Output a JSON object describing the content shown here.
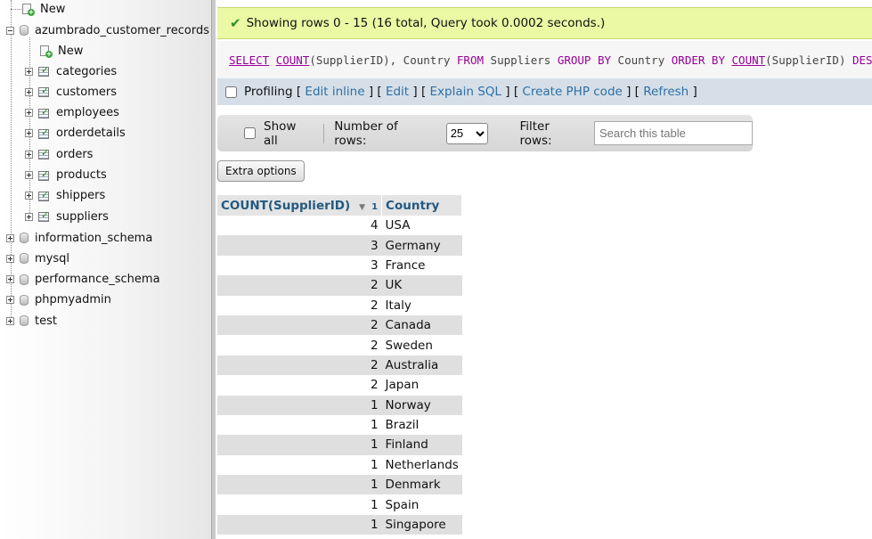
{
  "nav": {
    "top_new": "New",
    "database": "azumbrado_customer_records",
    "db_new": "New",
    "tables": [
      "categories",
      "customers",
      "employees",
      "orderdetails",
      "orders",
      "products",
      "shippers",
      "suppliers"
    ],
    "other_databases": [
      "information_schema",
      "mysql",
      "performance_schema",
      "phpmyadmin",
      "test"
    ]
  },
  "message": {
    "text": "Showing rows 0 - 15 (16 total, Query took 0.0002 seconds.)",
    "color": "#ebf8a4"
  },
  "sql": {
    "select": "SELECT",
    "count1": "COUNT",
    "part1": "(SupplierID), Country ",
    "from": "FROM",
    "part2": " Suppliers ",
    "group": "GROUP BY",
    "part3": " Country ",
    "order": "ORDER BY",
    "part4": " ",
    "count2": "COUNT",
    "part5": "(SupplierID) ",
    "desc": "DESC",
    "end": ";"
  },
  "sql_options": {
    "profiling": "Profiling",
    "edit_inline": "Edit inline",
    "edit": "Edit",
    "explain": "Explain SQL",
    "create_php": "Create PHP code",
    "refresh": "Refresh"
  },
  "controls": {
    "show_all": "Show all",
    "number_of_rows": "Number of rows:",
    "rows_value": "25",
    "filter_rows": "Filter rows:",
    "search_placeholder": "Search this table",
    "extra_options": "Extra options"
  },
  "table": {
    "col1": "COUNT(SupplierID)",
    "col1_sort_index": "1",
    "col2": "Country",
    "rows": [
      {
        "count": "4",
        "country": "USA"
      },
      {
        "count": "3",
        "country": "Germany"
      },
      {
        "count": "3",
        "country": "France"
      },
      {
        "count": "2",
        "country": "UK"
      },
      {
        "count": "2",
        "country": "Italy"
      },
      {
        "count": "2",
        "country": "Canada"
      },
      {
        "count": "2",
        "country": "Sweden"
      },
      {
        "count": "2",
        "country": "Australia"
      },
      {
        "count": "2",
        "country": "Japan"
      },
      {
        "count": "1",
        "country": "Norway"
      },
      {
        "count": "1",
        "country": "Brazil"
      },
      {
        "count": "1",
        "country": "Finland"
      },
      {
        "count": "1",
        "country": "Netherlands"
      },
      {
        "count": "1",
        "country": "Denmark"
      },
      {
        "count": "1",
        "country": "Spain"
      },
      {
        "count": "1",
        "country": "Singapore"
      }
    ]
  }
}
